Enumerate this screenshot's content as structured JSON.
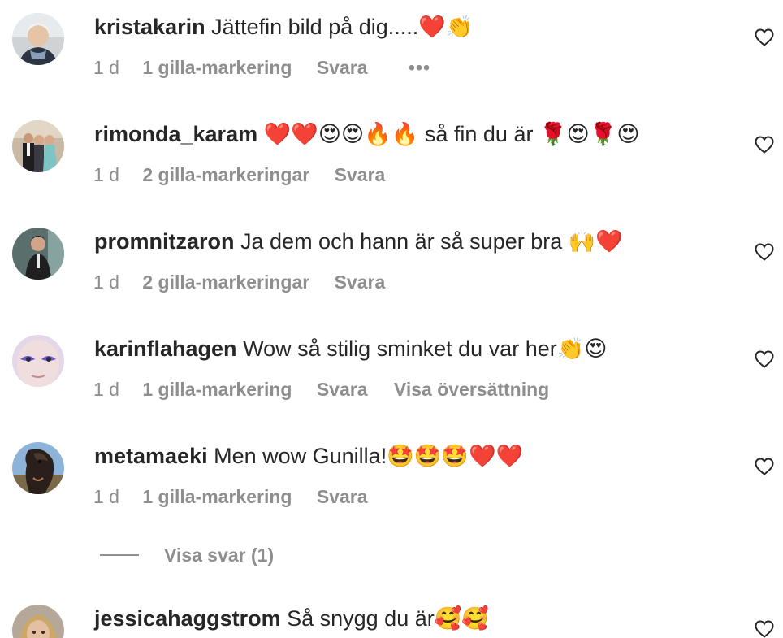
{
  "comments": [
    {
      "username": "kristakarin",
      "text": "Jättefin bild på dig.....❤️👏",
      "age": "1 d",
      "likes": "1 gilla-markering",
      "reply": "Svara",
      "more": "•••",
      "like_icon": "heart-outline-icon"
    },
    {
      "username": "rimonda_karam",
      "text": "❤️❤️😍😍🔥🔥 så fin du är 🌹😍🌹😍",
      "age": "1 d",
      "likes": "2 gilla-markeringar",
      "reply": "Svara",
      "like_icon": "heart-outline-icon"
    },
    {
      "username": "promnitzaron",
      "text": "Ja dem och hann är så super bra 🙌❤️",
      "age": "1 d",
      "likes": "2 gilla-markeringar",
      "reply": "Svara",
      "like_icon": "heart-outline-icon"
    },
    {
      "username": "karinflahagen",
      "text": "Wow så stilig sminket du var her👏😍",
      "age": "1 d",
      "likes": "1 gilla-markering",
      "reply": "Svara",
      "translate": "Visa översättning",
      "like_icon": "heart-outline-icon"
    },
    {
      "username": "metamaeki",
      "text": "Men wow Gunilla!🤩🤩🤩❤️❤️",
      "age": "1 d",
      "likes": "1 gilla-markering",
      "reply": "Svara",
      "like_icon": "heart-outline-icon"
    },
    {
      "username": "jessicahaggstrom",
      "text": "Så snygg du är🥰🥰",
      "like_icon": "heart-outline-icon"
    }
  ],
  "view_replies": "Visa svar (1)",
  "colors": {
    "text": "#262626",
    "secondary": "#8e8e8e"
  }
}
